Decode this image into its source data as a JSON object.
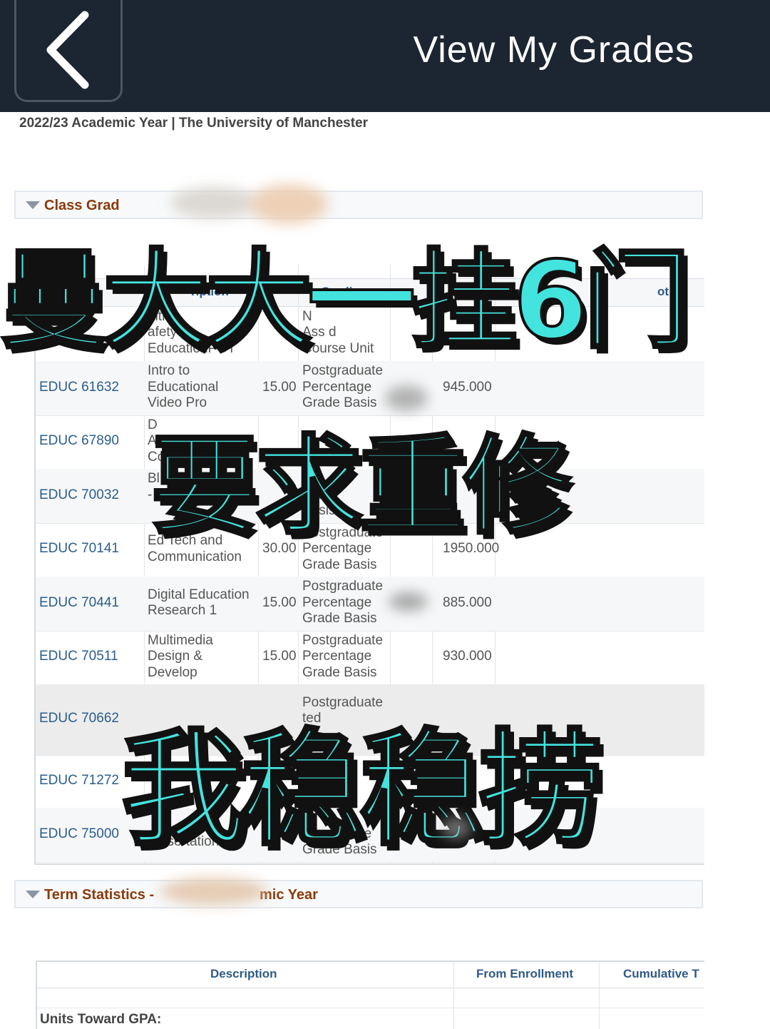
{
  "header": {
    "title": "View My Grades",
    "back_icon": "chevron-left-icon"
  },
  "subtitle": "2022/23 Academic Year | The University of Manchester",
  "class_grades_section": {
    "label": "Class Grad",
    "columns": {
      "description": "ription",
      "units": "U",
      "grading": "Gradi",
      "grade": "de",
      "points": "ot"
    },
    "rows": [
      {
        "code": "",
        "desc": [
          "alth",
          "afety",
          "EducationPGT"
        ],
        "units": "",
        "basis": [
          "N",
          "Ass    d",
          "Course Unit"
        ],
        "grade": ""
      },
      {
        "code": "EDUC 61632",
        "desc": [
          "Intro to",
          "Educational",
          "Video Pro"
        ],
        "units": "15.00",
        "basis": [
          "Postgraduate",
          "Percentage",
          "Grade Basis"
        ],
        "grade": "945.000"
      },
      {
        "code": "EDUC 67890",
        "desc": [
          "D",
          "Ad",
          "Co"
        ],
        "units": "",
        "basis": [
          "",
          "",
          ""
        ],
        "grade": ""
      },
      {
        "code": "EDUC 70032",
        "desc": [
          "Bl",
          "- Di",
          ""
        ],
        "units": "",
        "basis": [
          "ate",
          "ntag",
          "Basis"
        ],
        "grade": ""
      },
      {
        "code": "EDUC 70141",
        "desc": [
          "Ed Tech and",
          "Communication"
        ],
        "units": "30.00",
        "basis": [
          "Postgraduate",
          "Percentage",
          "Grade Basis"
        ],
        "grade": "1950.000"
      },
      {
        "code": "EDUC 70441",
        "desc": [
          "Digital Education",
          "Research 1"
        ],
        "units": "15.00",
        "basis": [
          "Postgraduate",
          "Percentage",
          "Grade Basis"
        ],
        "grade": "885.000"
      },
      {
        "code": "EDUC 70511",
        "desc": [
          "Multimedia",
          "Design &",
          "Develop"
        ],
        "units": "15.00",
        "basis": [
          "Postgraduate",
          "Percentage",
          "Grade Basis"
        ],
        "grade": "930.000"
      },
      {
        "code": "EDUC 70662",
        "desc": [
          "",
          "",
          ""
        ],
        "units": "",
        "basis": [
          "Postgraduate",
          "ted",
          ""
        ],
        "grade": ""
      },
      {
        "code": "EDUC 71272",
        "desc": [
          "",
          "",
          ""
        ],
        "units": "",
        "basis": [
          "",
          "",
          ""
        ],
        "grade": ""
      },
      {
        "code": "EDUC 75000",
        "desc": [
          "",
          "Dissertation"
        ],
        "units": "60.00",
        "basis": [
          "",
          "Percentage",
          "Grade Basis"
        ],
        "grade": ""
      }
    ]
  },
  "term_statistics_section": {
    "label_start": "Term Statistics -",
    "label_end": "mic Year",
    "columns": [
      "Description",
      "From Enrollment",
      "Cumulative T"
    ],
    "first_row": "Units Toward GPA:"
  },
  "overlay": {
    "line1": "曼大大一挂6门",
    "line2": "要求重修",
    "line3": "我稳稳捞"
  },
  "colors": {
    "topbar": "#1c2532",
    "overlay_fill": "#43e3de",
    "section_label": "#8b3a0a",
    "link": "#2a5d8f"
  }
}
